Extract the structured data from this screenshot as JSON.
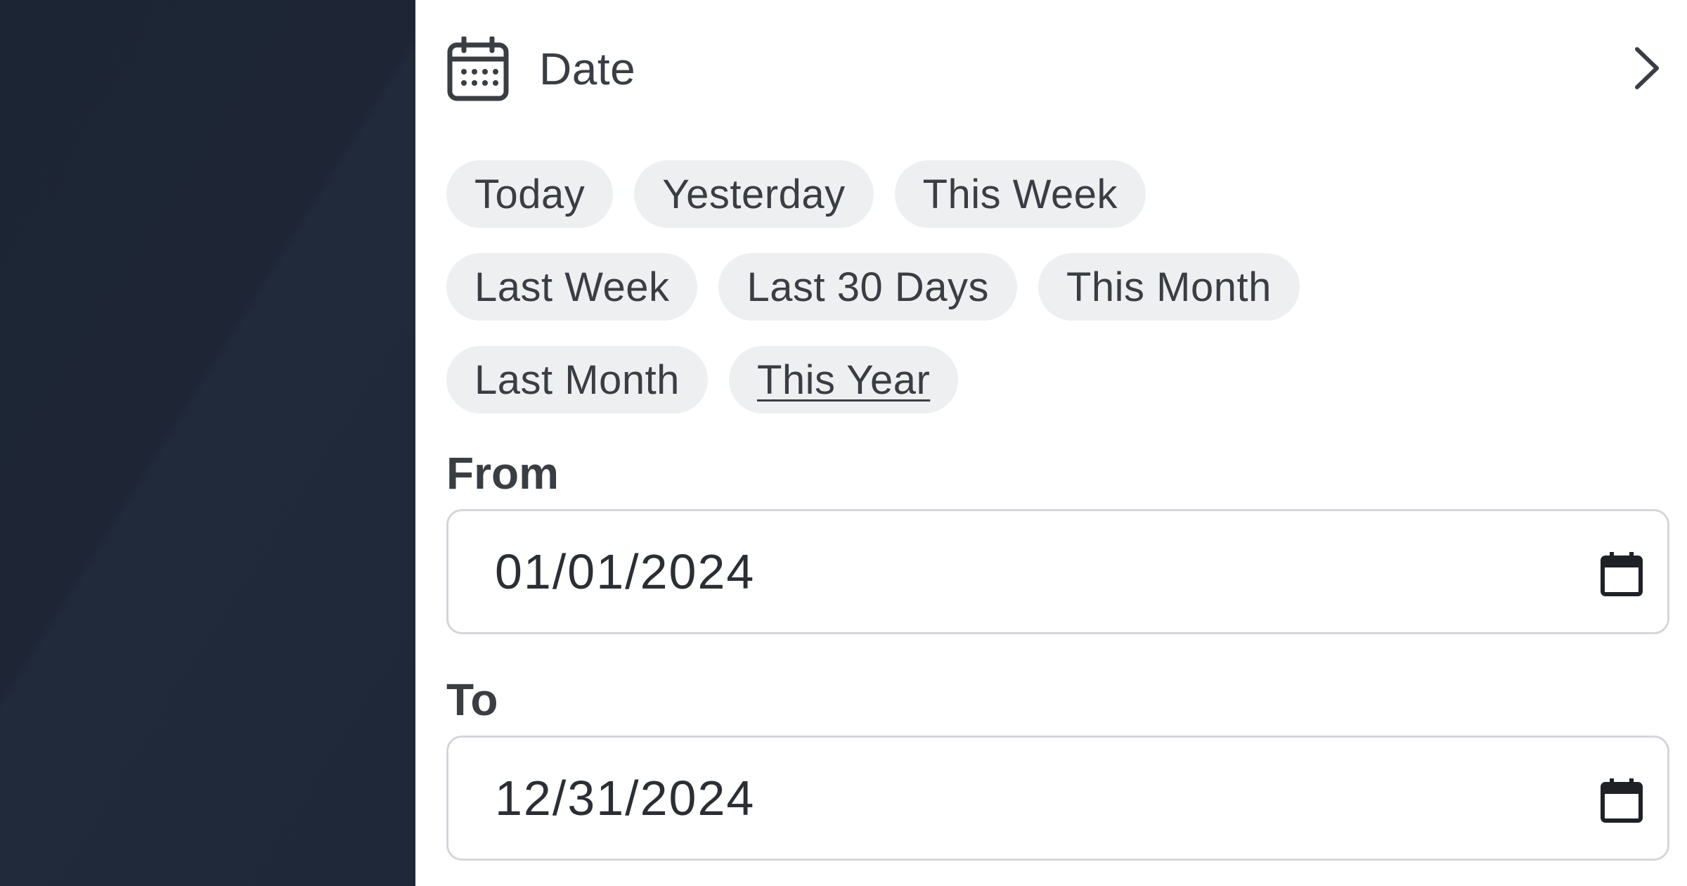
{
  "filter": {
    "title": "Date",
    "header_icon": "calendar-icon",
    "expand_icon": "chevron-right-icon",
    "presets": [
      [
        "Today",
        "Yesterday",
        "This Week"
      ],
      [
        "Last Week",
        "Last 30 Days",
        "This Month"
      ],
      [
        "Last Month",
        "This Year"
      ]
    ],
    "active_preset": "This Year",
    "from": {
      "label": "From",
      "value": "01/01/2024"
    },
    "to": {
      "label": "To",
      "value": "12/31/2024"
    }
  },
  "colors": {
    "backdrop": "#1e2636",
    "chip_bg": "#eeeff1",
    "text": "#3a3d42",
    "input_border": "#d4d6da"
  }
}
